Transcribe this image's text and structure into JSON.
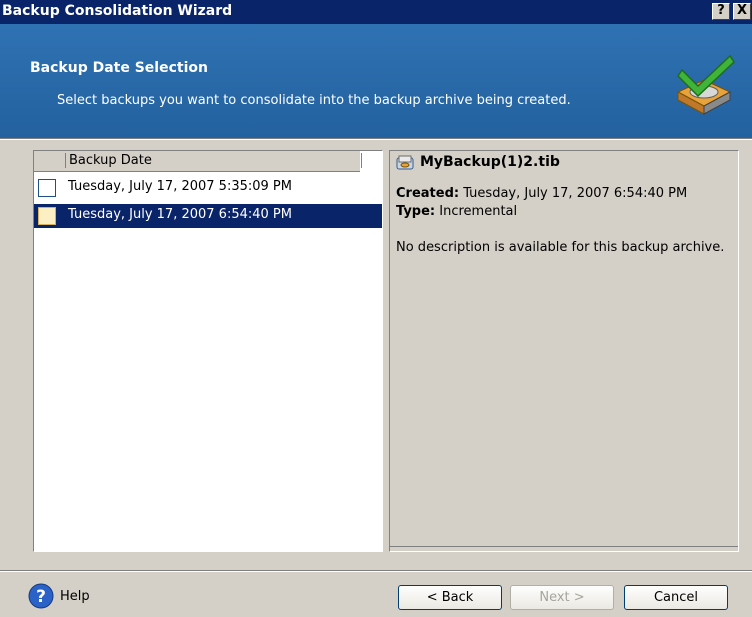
{
  "window": {
    "title": "Backup Consolidation Wizard",
    "help_button": "?",
    "close_button": "X"
  },
  "header": {
    "title": "Backup Date Selection",
    "subtitle": "Select backups you want to consolidate into the backup archive being created.",
    "icon": "wizard-disk-check-icon"
  },
  "list": {
    "column_header": "Backup Date",
    "rows": [
      {
        "label": "Tuesday, July 17, 2007 5:35:09 PM",
        "checked": false,
        "selected": false
      },
      {
        "label": "Tuesday, July 17, 2007 6:54:40 PM",
        "checked": false,
        "selected": true
      }
    ]
  },
  "details": {
    "file_name": "MyBackup(1)2.tib",
    "created_label": "Created:",
    "created_value": "Tuesday, July 17, 2007 6:54:40 PM",
    "type_label": "Type:",
    "type_value": "Incremental",
    "description": "No description is available for this backup archive."
  },
  "footer": {
    "help_label": "Help",
    "back_label": "< Back",
    "next_label": "Next >",
    "cancel_label": "Cancel"
  },
  "colors": {
    "titlebar": "#0a246a",
    "header": "#2b6aa8",
    "selection": "#0a246a",
    "dialog_bg": "#d4d0c8"
  }
}
